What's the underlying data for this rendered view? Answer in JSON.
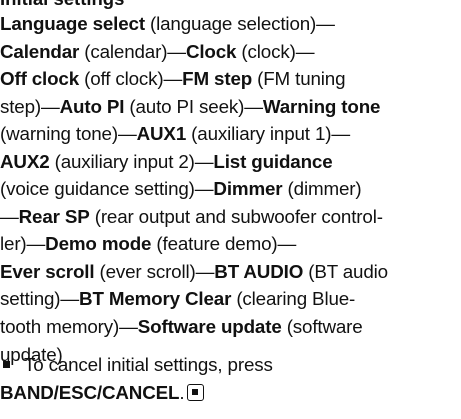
{
  "heading": "Initial settings",
  "items": [
    {
      "term": "Language select",
      "desc": "language selection"
    },
    {
      "term": "Calendar",
      "desc": "calendar"
    },
    {
      "term": "Clock",
      "desc": "clock"
    },
    {
      "term": "Off clock",
      "desc": "off clock"
    },
    {
      "term": "FM step",
      "desc": "FM tuning step"
    },
    {
      "term": "Auto PI",
      "desc": "auto PI seek"
    },
    {
      "term": "Warning tone",
      "desc": "warning tone"
    },
    {
      "term": "AUX1",
      "desc": "auxiliary input 1"
    },
    {
      "term": "AUX2",
      "desc": "auxiliary input 2"
    },
    {
      "term": "List guidance",
      "desc": "voice guidance setting"
    },
    {
      "term": "Dimmer",
      "desc": "dimmer"
    },
    {
      "term": "Rear SP",
      "desc": "rear output and subwoofer controller"
    },
    {
      "term": "Demo mode",
      "desc": "feature demo"
    },
    {
      "term": "Ever scroll",
      "desc": "ever scroll"
    },
    {
      "term": "BT AUDIO",
      "desc": "BT audio setting"
    },
    {
      "term": "BT Memory Clear",
      "desc": "clearing Bluetooth memory"
    },
    {
      "term": "Software update",
      "desc": "software update"
    }
  ],
  "note": {
    "text": "To cancel initial settings, press",
    "keys": "BAND/ESC/CANCEL",
    "end_icon": "end-of-section-icon"
  }
}
